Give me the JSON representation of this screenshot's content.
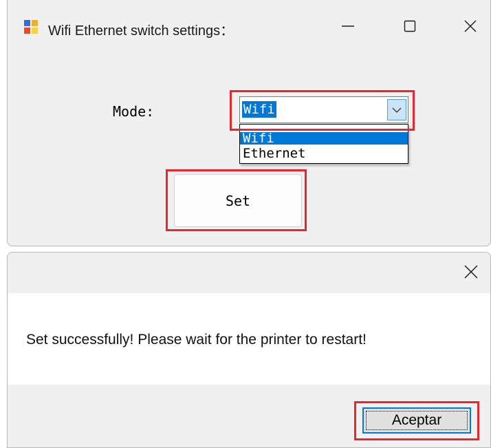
{
  "settings_window": {
    "title": "Wifi Ethernet switch settings：",
    "mode_label": "Mode:",
    "mode_value": "Wifi",
    "mode_options": [
      "Wifi",
      "Ethernet"
    ],
    "set_button": "Set",
    "caption_icons": [
      "minimize-icon",
      "maximize-icon",
      "close-icon"
    ]
  },
  "message_dialog": {
    "message": "Set successfully! Please wait for the printer to restart!",
    "ok_button": "Aceptar",
    "caption_icons": [
      "close-icon"
    ]
  },
  "colors": {
    "highlight": "#e8262b",
    "selection": "#0078d7",
    "window_bg": "#f0f0f0"
  }
}
